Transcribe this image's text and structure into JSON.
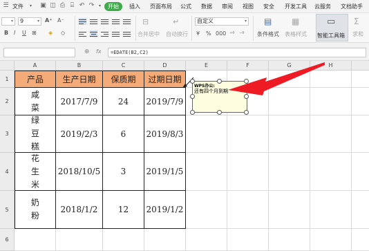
{
  "menu": {
    "file": "文件",
    "tabs": [
      "开始",
      "插入",
      "页面布局",
      "公式",
      "数据",
      "审阅",
      "视图",
      "安全",
      "开发工具",
      "云服务",
      "文档助手"
    ]
  },
  "ribbon": {
    "font_size": "9",
    "number_format": "自定义",
    "merge_center": "合并居中",
    "auto_wrap": "自动换行",
    "conditional_format": "条件格式",
    "table_style": "表格样式",
    "smart_toolbox": "智能工具箱",
    "sum": "求和",
    "currency_symbol": "¥",
    "percent": "%",
    "thousands": "000"
  },
  "formula_bar": {
    "fx": "fx",
    "formula": "=EDATE(B2,C2)"
  },
  "columns": [
    "A",
    "B",
    "C",
    "D",
    "E",
    "F",
    "G",
    "H"
  ],
  "rows": [
    "1",
    "2",
    "3",
    "4",
    "5",
    "6"
  ],
  "table": {
    "headers": [
      "产品",
      "生产日期",
      "保质期",
      "过期日期"
    ],
    "rows": [
      {
        "product": [
          "咸",
          "菜"
        ],
        "produced": "2017/7/9",
        "shelf_life": "24",
        "expiry": "2019/7/9"
      },
      {
        "product": [
          "绿",
          "豆",
          "糕"
        ],
        "produced": "2019/2/3",
        "shelf_life": "6",
        "expiry": "2019/8/3"
      },
      {
        "product": [
          "花",
          "生",
          "米"
        ],
        "produced": "2018/10/5",
        "shelf_life": "3",
        "expiry": "2019/1/5"
      },
      {
        "product": [
          "奶",
          "粉"
        ],
        "produced": "2018/1/2",
        "shelf_life": "12",
        "expiry": "2019/1/2"
      }
    ]
  },
  "comment": {
    "author": "WPS办公:",
    "text": "还有四个月到期"
  },
  "colors": {
    "start_tab": "#3dab48",
    "header_fill": "#f5ab78",
    "arrow": "#ee1b24",
    "comment_bg": "#fdfde0"
  }
}
